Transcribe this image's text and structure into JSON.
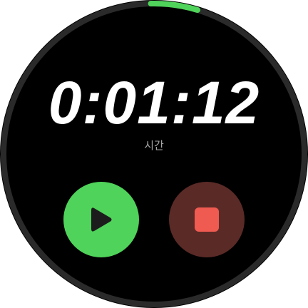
{
  "timer": {
    "elapsed": "0:01:12",
    "label": "시간",
    "progress_fraction": 0.05
  },
  "controls": {
    "play_icon": "play-icon",
    "stop_icon": "stop-icon"
  },
  "colors": {
    "background": "#000000",
    "ring_track": "#2a2a2a",
    "ring_progress": "#4fd35a",
    "play_button": "#4fd35a",
    "play_icon": "#1c1c1c",
    "stop_button": "#5a2a27",
    "stop_icon": "#ef5b50",
    "text_primary": "#ffffff",
    "text_secondary": "#a8a8a8"
  }
}
